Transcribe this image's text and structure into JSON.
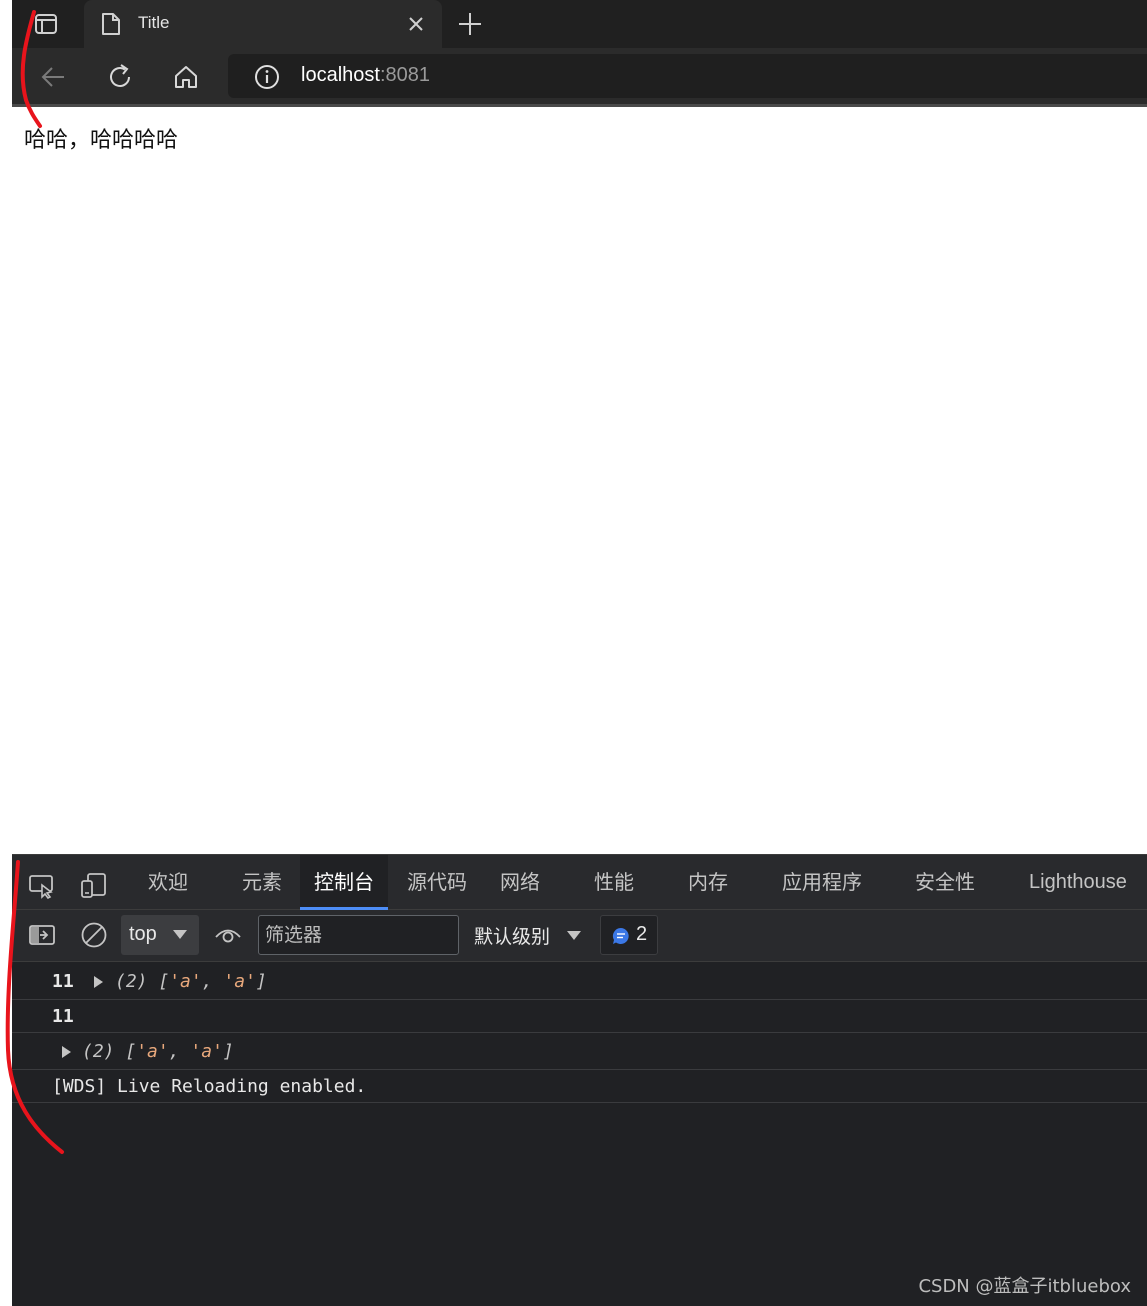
{
  "browser": {
    "tab_title": "Title",
    "url_host": "localhost",
    "url_port": ":8081"
  },
  "page": {
    "text": "哈哈，哈哈哈哈"
  },
  "devtools": {
    "tabs": [
      "欢迎",
      "元素",
      "控制台",
      "源代码",
      "网络",
      "性能",
      "内存",
      "应用程序",
      "安全性",
      "Lighthouse"
    ],
    "active_tab": "控制台",
    "context": "top",
    "filter_placeholder": "筛选器",
    "level": "默认级别",
    "message_count": "2",
    "console": {
      "row1_num": "11",
      "row1_arr_prefix": "(2) [",
      "row1_item1": "'a'",
      "row1_sep": ", ",
      "row1_item2": "'a'",
      "row1_suffix": "]",
      "row2_num": "11",
      "row3_arr_prefix": "(2) [",
      "row3_item1": "'a'",
      "row3_sep": ", ",
      "row3_item2": "'a'",
      "row3_suffix": "]",
      "row4_text": "[WDS] Live Reloading enabled."
    }
  },
  "watermark": "CSDN @蓝盒子itbluebox",
  "colors": {
    "chrome_bg": "#2b2b2b",
    "devtools_bg": "#202124",
    "active_tab_accent": "#4d8df6",
    "string_color": "#e8a87c",
    "annotation_red": "#e8141c"
  }
}
